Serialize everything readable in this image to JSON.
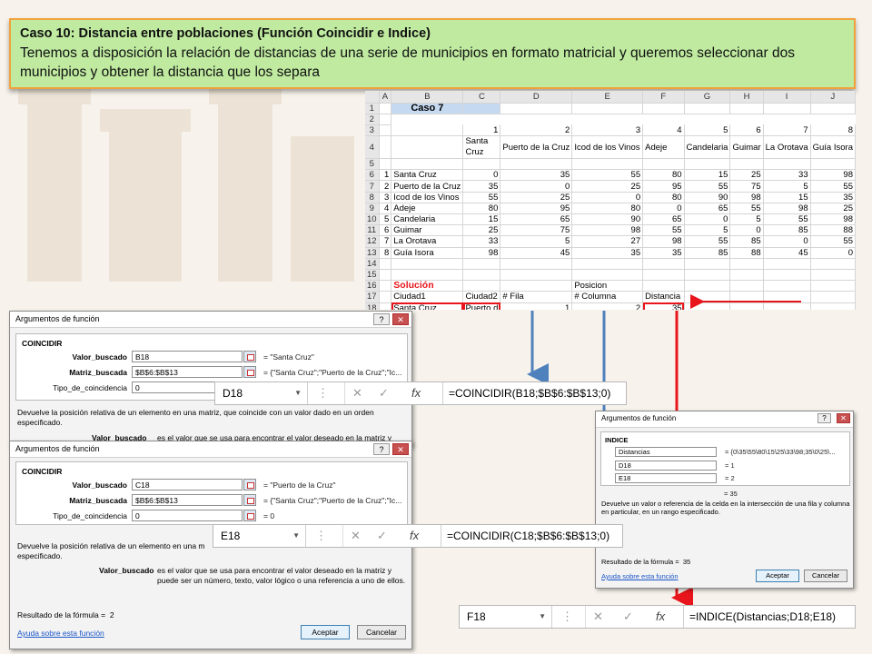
{
  "banner": {
    "title": "Caso 10: Distancia entre poblaciones (Función Coincidir e Indice)",
    "body": "Tenemos a disposición la relación de distancias de una serie de municipios en formato matricial y queremos seleccionar dos municipios y obtener la distancia que los separa"
  },
  "sheet": {
    "col_headers": [
      "A",
      "B",
      "C",
      "D",
      "E",
      "F",
      "G",
      "H",
      "I",
      "J"
    ],
    "caso_title": "Caso 7",
    "index_row": [
      "1",
      "2",
      "3",
      "4",
      "5",
      "6",
      "7",
      "8"
    ],
    "col_towns": [
      "Santa Cruz",
      "Puerto de la Cruz",
      "Icod de los Vinos",
      "Adeje",
      "Candelaria",
      "Guimar",
      "La Orotava",
      "Guía Isora"
    ],
    "rows": [
      {
        "n": "1",
        "town": "Santa Cruz",
        "vals": [
          "0",
          "35",
          "55",
          "80",
          "15",
          "25",
          "33",
          "98"
        ]
      },
      {
        "n": "2",
        "town": "Puerto de la Cruz",
        "vals": [
          "35",
          "0",
          "25",
          "95",
          "55",
          "75",
          "5",
          "55"
        ]
      },
      {
        "n": "3",
        "town": "Icod de los Vinos",
        "vals": [
          "55",
          "25",
          "0",
          "80",
          "90",
          "98",
          "15",
          "35"
        ]
      },
      {
        "n": "4",
        "town": "Adeje",
        "vals": [
          "80",
          "95",
          "80",
          "0",
          "65",
          "55",
          "98",
          "25"
        ]
      },
      {
        "n": "5",
        "town": "Candelaria",
        "vals": [
          "15",
          "65",
          "90",
          "65",
          "0",
          "5",
          "55",
          "98"
        ]
      },
      {
        "n": "6",
        "town": "Guimar",
        "vals": [
          "25",
          "75",
          "98",
          "55",
          "5",
          "0",
          "85",
          "88"
        ]
      },
      {
        "n": "7",
        "town": "La Orotava",
        "vals": [
          "33",
          "5",
          "27",
          "98",
          "55",
          "85",
          "0",
          "55"
        ]
      },
      {
        "n": "8",
        "town": "Guía Isora",
        "vals": [
          "98",
          "45",
          "35",
          "35",
          "85",
          "88",
          "45",
          "0"
        ]
      }
    ],
    "solucion": "Solución",
    "posicion": "Posicion",
    "hdr_ciudad1": "Ciudad1",
    "hdr_ciudad2": "Ciudad2",
    "hdr_fila": "# Fila",
    "hdr_columna": "# Columna",
    "hdr_distancia": "Distancia",
    "val_ciudad1": "Santa Cruz",
    "val_ciudad2": "Puerto d",
    "val_fila": "1",
    "val_columna": "2",
    "val_distancia": "35"
  },
  "dialog1": {
    "title": "Argumentos de función",
    "func": "COINCIDIR",
    "lbl_valor": "Valor_buscado",
    "lbl_matriz": "Matriz_buscada",
    "lbl_tipo": "Tipo_de_coincidencia",
    "in_valor": "B18",
    "in_matriz": "$B$6:$B$13",
    "in_tipo": "0",
    "res_valor": "\"Santa Cruz\"",
    "res_matriz": "{\"Santa Cruz\";\"Puerto de la Cruz\";\"Ic...",
    "desc": "Devuelve la posición relativa de un elemento en una matriz, que coincide con un valor dado en un orden especificado.",
    "arg_desc_lbl": "Valor_buscado",
    "arg_desc": "es el valor que se usa para encontrar el valor deseado en la matriz y"
  },
  "dialog2": {
    "title": "Argumentos de función",
    "func": "COINCIDIR",
    "lbl_valor": "Valor_buscado",
    "lbl_matriz": "Matriz_buscada",
    "lbl_tipo": "Tipo_de_coincidencia",
    "in_valor": "C18",
    "in_matriz": "$B$6:$B$13",
    "in_tipo": "0",
    "res_valor": "\"Puerto de la Cruz\"",
    "res_matriz": "{\"Santa Cruz\";\"Puerto de la Cruz\";\"Ic...",
    "res_tipo": "0",
    "desc": "Devuelve la posición relativa de un elemento en una m",
    "desc2": "especificado.",
    "arg_desc_lbl": "Valor_buscado",
    "arg_desc": "es el valor que se usa para encontrar el valor deseado en la matriz y",
    "arg_desc2": "puede ser un número, texto, valor lógico o una referencia a uno de ellos.",
    "result_lbl": "Resultado de la fórmula =",
    "result_val": "2",
    "help": "Ayuda sobre esta función",
    "ok": "Aceptar",
    "cancel": "Cancelar"
  },
  "dialog3": {
    "title": "Argumentos de función",
    "func": "INDICE",
    "in1": "Distancias",
    "in2": "D18",
    "in3": "E18",
    "res1": "{0\\35\\55\\80\\15\\25\\33\\98;35\\0\\25\\...",
    "res2": "1",
    "res3": "2",
    "res_total": "35",
    "desc": "Devuelve un valor o referencia de la celda en la intersección de una fila y columna",
    "desc2": "en particular, en un rango especificado.",
    "result_lbl": "Resultado de la fórmula =",
    "result_val": "35",
    "help": "Ayuda sobre esta función",
    "ok": "Aceptar",
    "cancel": "Cancelar"
  },
  "formula_bars": [
    {
      "name": "D18",
      "formula": "=COINCIDIR(B18;$B$6:$B$13;0)"
    },
    {
      "name": "E18",
      "formula": "=COINCIDIR(C18;$B$6:$B$13;0)"
    },
    {
      "name": "F18",
      "formula": "=INDICE(Distancias;D18;E18)"
    }
  ],
  "colors": {
    "banner_bg": "#bfeaa0",
    "banner_border": "#f2a23c",
    "arrow_blue": "#4f81bd",
    "arrow_red": "#e8161c"
  }
}
